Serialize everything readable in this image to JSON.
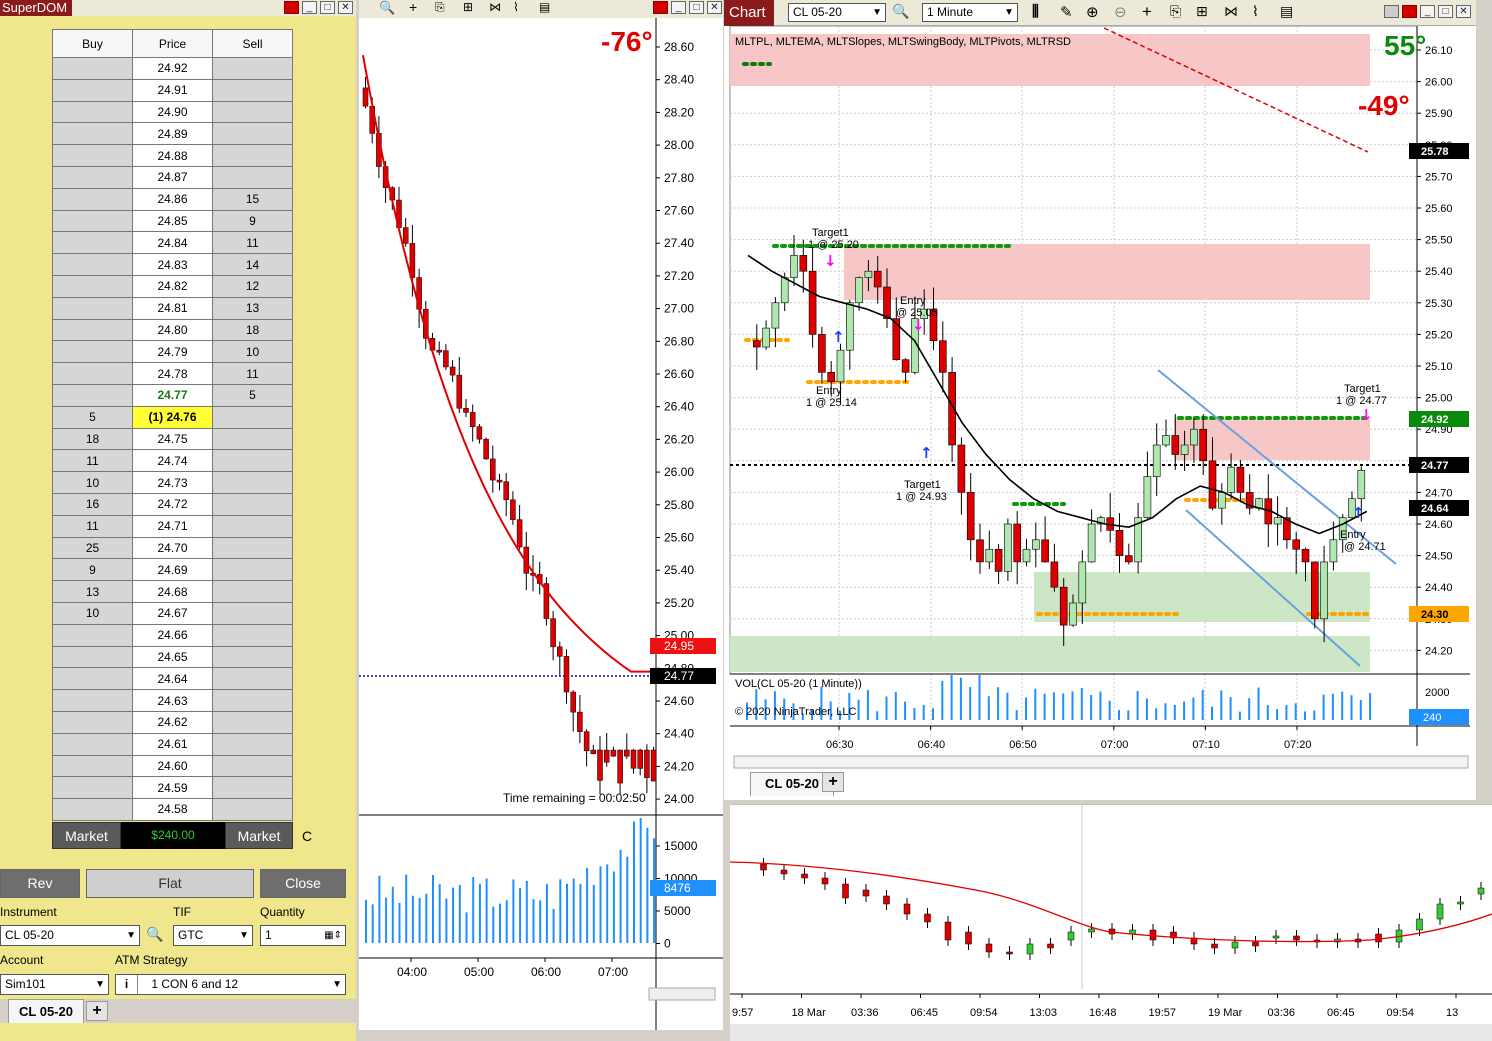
{
  "dom": {
    "title": "SuperDOM",
    "headers": {
      "buy": "Buy",
      "price": "Price",
      "sell": "Sell"
    },
    "rows": [
      {
        "buy": "",
        "price": "24.92",
        "sell": ""
      },
      {
        "buy": "",
        "price": "24.91",
        "sell": ""
      },
      {
        "buy": "",
        "price": "24.90",
        "sell": ""
      },
      {
        "buy": "",
        "price": "24.89",
        "sell": ""
      },
      {
        "buy": "",
        "price": "24.88",
        "sell": ""
      },
      {
        "buy": "",
        "price": "24.87",
        "sell": ""
      },
      {
        "buy": "",
        "price": "24.86",
        "sell": "15"
      },
      {
        "buy": "",
        "price": "24.85",
        "sell": "9"
      },
      {
        "buy": "",
        "price": "24.84",
        "sell": "11"
      },
      {
        "buy": "",
        "price": "24.83",
        "sell": "14"
      },
      {
        "buy": "",
        "price": "24.82",
        "sell": "12"
      },
      {
        "buy": "",
        "price": "24.81",
        "sell": "13"
      },
      {
        "buy": "",
        "price": "24.80",
        "sell": "18"
      },
      {
        "buy": "",
        "price": "24.79",
        "sell": "10"
      },
      {
        "buy": "",
        "price": "24.78",
        "sell": "11"
      },
      {
        "buy": "",
        "price": "24.77",
        "sell": "5",
        "type": "last"
      },
      {
        "buy": "5",
        "price": "(1) 24.76",
        "sell": "",
        "type": "pos"
      },
      {
        "buy": "18",
        "price": "24.75",
        "sell": ""
      },
      {
        "buy": "11",
        "price": "24.74",
        "sell": ""
      },
      {
        "buy": "10",
        "price": "24.73",
        "sell": ""
      },
      {
        "buy": "16",
        "price": "24.72",
        "sell": ""
      },
      {
        "buy": "11",
        "price": "24.71",
        "sell": ""
      },
      {
        "buy": "25",
        "price": "24.70",
        "sell": ""
      },
      {
        "buy": "9",
        "price": "24.69",
        "sell": ""
      },
      {
        "buy": "13",
        "price": "24.68",
        "sell": ""
      },
      {
        "buy": "10",
        "price": "24.67",
        "sell": ""
      },
      {
        "buy": "",
        "price": "24.66",
        "sell": ""
      },
      {
        "buy": "",
        "price": "24.65",
        "sell": ""
      },
      {
        "buy": "",
        "price": "24.64",
        "sell": ""
      },
      {
        "buy": "",
        "price": "24.63",
        "sell": ""
      },
      {
        "buy": "",
        "price": "24.62",
        "sell": ""
      },
      {
        "buy": "",
        "price": "24.61",
        "sell": ""
      },
      {
        "buy": "",
        "price": "24.60",
        "sell": ""
      },
      {
        "buy": "",
        "price": "24.59",
        "sell": ""
      },
      {
        "buy": "",
        "price": "24.58",
        "sell": ""
      }
    ],
    "market_buy": "Market",
    "pnl": "$240.00",
    "market_sell": "Market",
    "c_label": "C",
    "rev": "Rev",
    "flat": "Flat",
    "close": "Close",
    "instrument_label": "Instrument",
    "instrument": "CL 05-20",
    "tif_label": "TIF",
    "tif": "GTC",
    "quantity_label": "Quantity",
    "quantity": "1",
    "account_label": "Account",
    "account": "Sim101",
    "atm_label": "ATM Strategy",
    "atm": "1 CON 6 and 12",
    "tab": "CL 05-20"
  },
  "mid": {
    "angle": "-76°",
    "price_ticks": [
      "28.60",
      "28.40",
      "28.20",
      "28.00",
      "27.80",
      "27.60",
      "27.40",
      "27.20",
      "27.00",
      "26.80",
      "26.60",
      "26.40",
      "26.20",
      "26.00",
      "25.80",
      "25.60",
      "25.40",
      "25.20",
      "25.00",
      "24.80",
      "24.60",
      "24.40",
      "24.20",
      "24.00"
    ],
    "red_tag": "24.95",
    "black_tag": "24.77",
    "time_remaining": "Time remaining = 00:02:50",
    "vol_ticks": [
      "15000",
      "10000",
      "5000",
      "0"
    ],
    "vol_tag": "8476",
    "time_labels": [
      "04:00",
      "05:00",
      "06:00",
      "07:00"
    ]
  },
  "rc": {
    "title": "Chart",
    "instrument": "CL 05-20",
    "interval": "1 Minute",
    "indicators": "MLTPL, MLTEMA, MLTSlopes, MLTSwingBody, MLTPivots, MLTRSD",
    "angle_up": "55°",
    "angle_down": "-49°",
    "price_ticks": [
      "26.10",
      "26.00",
      "25.90",
      "25.80",
      "25.70",
      "25.60",
      "25.50",
      "25.40",
      "25.30",
      "25.20",
      "25.10",
      "25.00",
      "24.90",
      "24.80",
      "24.70",
      "24.60",
      "24.50",
      "24.40",
      "24.30",
      "24.20"
    ],
    "tags": {
      "t1": "25.78",
      "t2": "24.92",
      "t3": "24.77",
      "t4": "24.64",
      "t5": "24.30"
    },
    "annotations": {
      "target1_a": "Target1",
      "target1_a2": "1 @ 25.20",
      "entry_a": "Entry",
      "entry_a2": "1 @ 25.14",
      "entry_b": "Entry",
      "entry_b2": "@ 25.05",
      "target1_b": "Target1",
      "target1_b2": "1 @ 24.93",
      "target1_c": "Target1",
      "target1_c2": "1 @ 24.77",
      "entry_c": "Entry",
      "entry_c2": "@ 24.71"
    },
    "vol_label": "VOL(CL 05-20 (1 Minute))",
    "copyright": "© 2020 NinjaTrader, LLC",
    "vol_tick": "2000",
    "vol_tag": "240",
    "time_labels": [
      "06:30",
      "06:40",
      "06:50",
      "07:00",
      "07:10",
      "07:20"
    ],
    "tab": "CL 05-20"
  },
  "bot": {
    "time_labels": [
      "9:57",
      "18 Mar",
      "03:36",
      "06:45",
      "09:54",
      "13:03",
      "16:48",
      "19:57",
      "19 Mar",
      "03:36",
      "06:45",
      "09:54",
      "13"
    ]
  }
}
